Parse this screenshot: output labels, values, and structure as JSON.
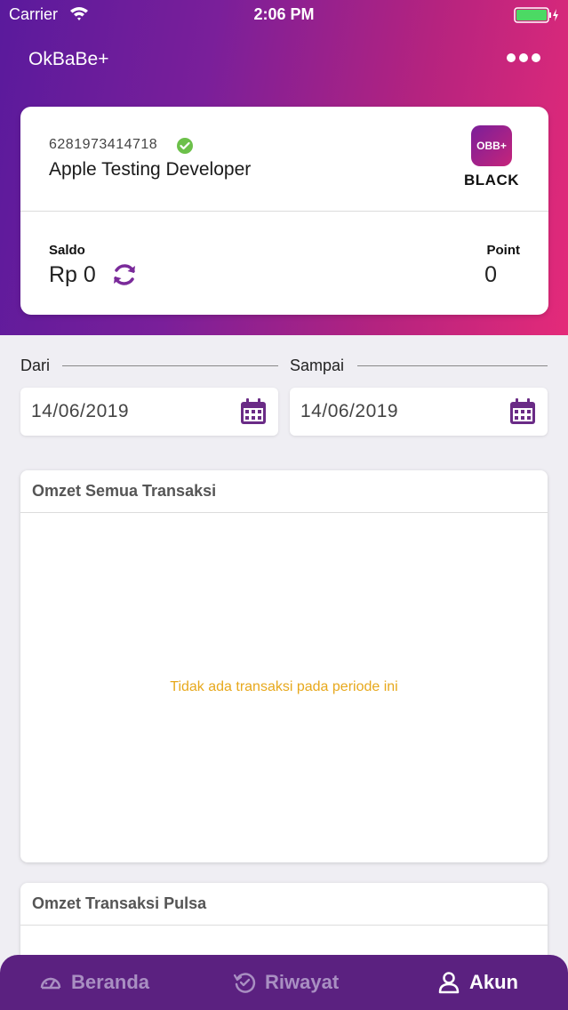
{
  "status_bar": {
    "carrier": "Carrier",
    "time": "2:06 PM"
  },
  "app": {
    "title": "OkBaBe+"
  },
  "profile": {
    "phone": "6281973414718",
    "name": "Apple Testing Developer",
    "member_logo": "OBB+",
    "member_level": "BLACK",
    "saldo_label": "Saldo",
    "saldo_value": "Rp 0",
    "point_label": "Point",
    "point_value": "0"
  },
  "filter": {
    "from_label": "Dari",
    "from_value": "14/06/2019",
    "to_label": "Sampai",
    "to_value": "14/06/2019"
  },
  "panels": [
    {
      "title": "Omzet Semua Transaksi",
      "empty_text": "Tidak ada transaksi pada periode ini"
    },
    {
      "title": "Omzet Transaksi Pulsa"
    }
  ],
  "tabs": [
    {
      "label": "Beranda",
      "icon": "dashboard-icon",
      "active": false
    },
    {
      "label": "Riwayat",
      "icon": "history-icon",
      "active": false
    },
    {
      "label": "Akun",
      "icon": "user-icon",
      "active": true
    }
  ],
  "colors": {
    "accent": "#5b2180",
    "highlight": "#e42a79",
    "empty_text": "#e7a81c",
    "verified": "#6cc04a"
  }
}
